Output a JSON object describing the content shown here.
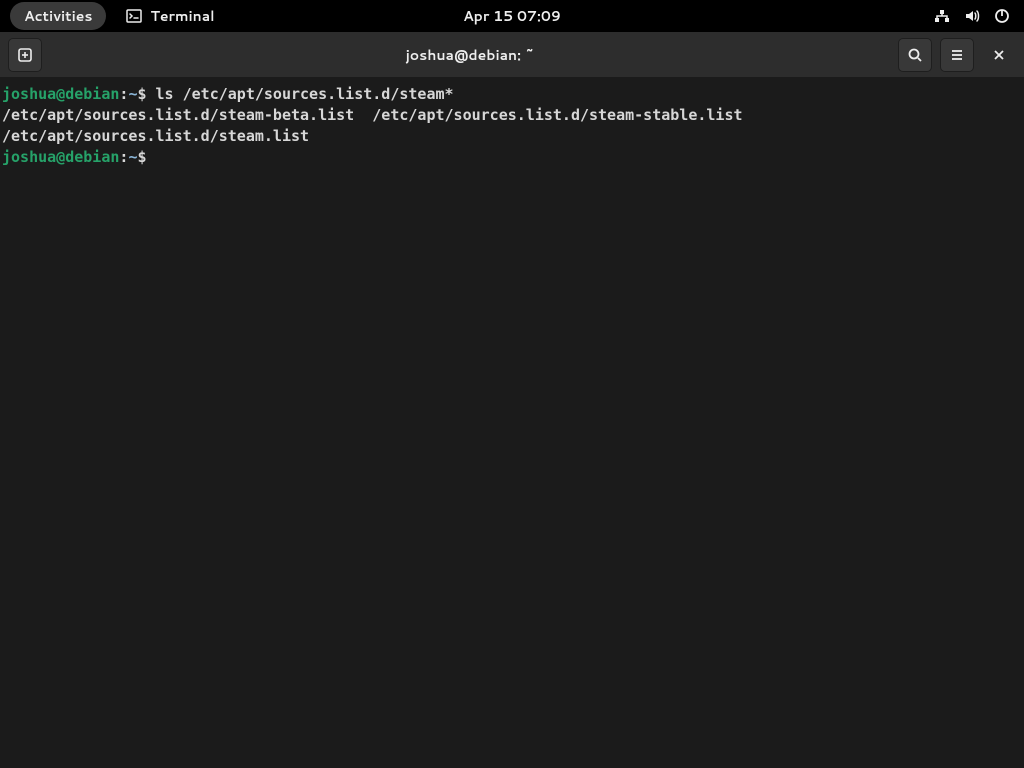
{
  "topbar": {
    "activities": "Activities",
    "app_name": "Terminal",
    "clock": "Apr 15  07:09"
  },
  "window": {
    "title": "joshua@debian: ~"
  },
  "terminal": {
    "prompt1": {
      "userhost": "joshua@debian",
      "colon": ":",
      "path": "~",
      "dollar": "$ ",
      "command": "ls /etc/apt/sources.list.d/steam*"
    },
    "output_line1": "/etc/apt/sources.list.d/steam-beta.list  /etc/apt/sources.list.d/steam-stable.list",
    "output_line2": "/etc/apt/sources.list.d/steam.list",
    "prompt2": {
      "userhost": "joshua@debian",
      "colon": ":",
      "path": "~",
      "dollar": "$ "
    }
  }
}
